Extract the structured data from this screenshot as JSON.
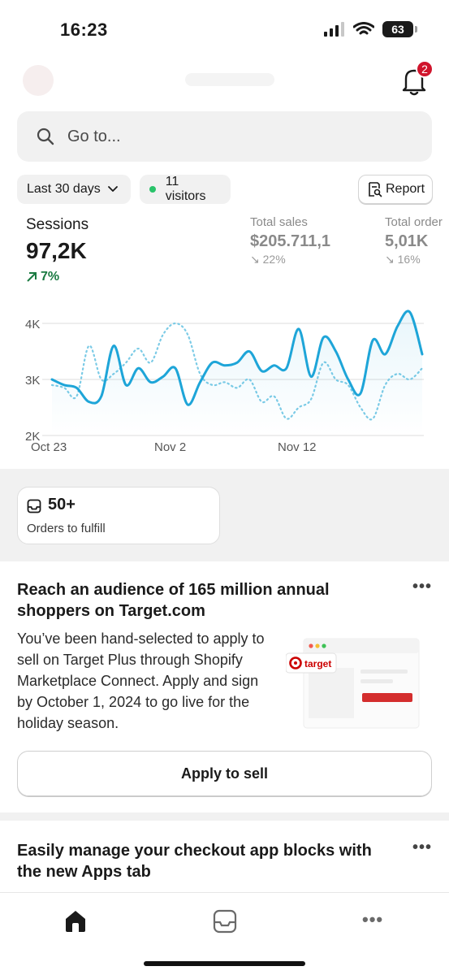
{
  "status_bar": {
    "time": "16:23",
    "battery": "63",
    "icons": [
      "cellular-signal-icon",
      "wifi-icon",
      "battery-icon"
    ]
  },
  "notifications": {
    "icon": "bell-icon",
    "badge_count": "2"
  },
  "search": {
    "placeholder": "Go to...",
    "icon": "search-icon"
  },
  "filters": {
    "date_range": "Last 30 days",
    "visitors": "11 visitors",
    "report_label": "Report"
  },
  "metrics": {
    "sessions": {
      "label": "Sessions",
      "value": "97,2K",
      "change": "7%"
    },
    "total_sales": {
      "label": "Total sales",
      "value": "$205.711,1",
      "change": "22%"
    },
    "total_orders": {
      "label": "Total order",
      "value": "5,01K",
      "change": "16%"
    }
  },
  "chart_data": {
    "type": "line",
    "xticks": [
      "Oct 23",
      "Nov 2",
      "Nov 12"
    ],
    "yticks": [
      "4K",
      "3K",
      "2K"
    ],
    "ylim": [
      2000,
      4300
    ],
    "x": [
      1,
      2,
      3,
      4,
      5,
      6,
      7,
      8,
      9,
      10,
      11,
      12,
      13,
      14,
      15,
      16,
      17,
      18,
      19,
      20,
      21,
      22,
      23,
      24,
      25,
      26,
      27,
      28,
      29,
      30,
      31
    ],
    "series": [
      {
        "style": "solid",
        "color": "#1ea5d8",
        "values": [
          3000,
          2900,
          2850,
          2600,
          2700,
          3600,
          2900,
          3200,
          2950,
          3050,
          3200,
          2550,
          2950,
          3300,
          3250,
          3300,
          3500,
          3150,
          3250,
          3200,
          3900,
          3050,
          3750,
          3500,
          3000,
          2750,
          3700,
          3450,
          3950,
          4200,
          3450
        ]
      },
      {
        "style": "dotted",
        "color": "#7ccbe6",
        "values": [
          2900,
          2850,
          2700,
          3600,
          3000,
          3100,
          3300,
          3550,
          3300,
          3800,
          4000,
          3800,
          3100,
          2900,
          2950,
          2850,
          3000,
          2600,
          2700,
          2300,
          2500,
          2650,
          3300,
          3000,
          2900,
          2500,
          2300,
          2900,
          3100,
          3000,
          3200
        ]
      }
    ]
  },
  "fulfill": {
    "icon": "inbox-icon",
    "count": "50+",
    "label": "Orders to fulfill"
  },
  "promo": {
    "title": "Reach an audience of 165 million annual shoppers on Target.com",
    "body": "You’ve been hand-selected to apply to sell on Target Plus through Shopify Marketplace Connect. Apply and sign by October 1, 2024 to go live for the holiday season.",
    "illustration_logo_text": "target",
    "cta": "Apply to sell",
    "more": "•••"
  },
  "promo2": {
    "title": "Easily manage your checkout app blocks with the new Apps tab",
    "more": "•••"
  },
  "bottom_nav": {
    "items": [
      "home-icon",
      "orders-icon",
      "more-icon"
    ],
    "more_glyph": "•••"
  },
  "colors": {
    "accent_line": "#1ea5d8",
    "comparison_line": "#7ccbe6",
    "positive": "#1a7a41",
    "badge": "#d0142c"
  }
}
